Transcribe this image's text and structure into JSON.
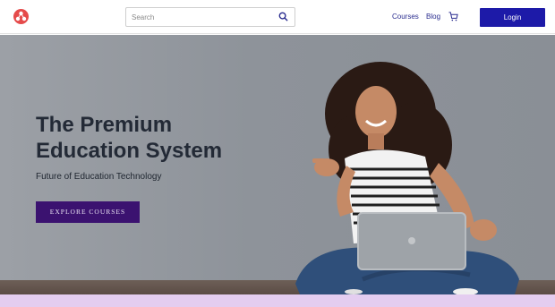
{
  "header": {
    "logo_icon": "molecule-logo-icon",
    "search": {
      "placeholder": "Search",
      "value": "",
      "icon": "search-icon"
    },
    "nav": [
      {
        "label": "Courses"
      },
      {
        "label": "Blog"
      }
    ],
    "cart_icon": "cart-icon",
    "login_label": "Login"
  },
  "hero": {
    "title": "The Premium Education System",
    "subtitle": "Future of Education Technology",
    "cta_label": "EXPLORE COURSES"
  },
  "colors": {
    "brand_blue": "#1d1aa8",
    "cta_purple": "#3b1270",
    "logo_red": "#e54b4b",
    "band_lavender": "#e4cdf0"
  }
}
